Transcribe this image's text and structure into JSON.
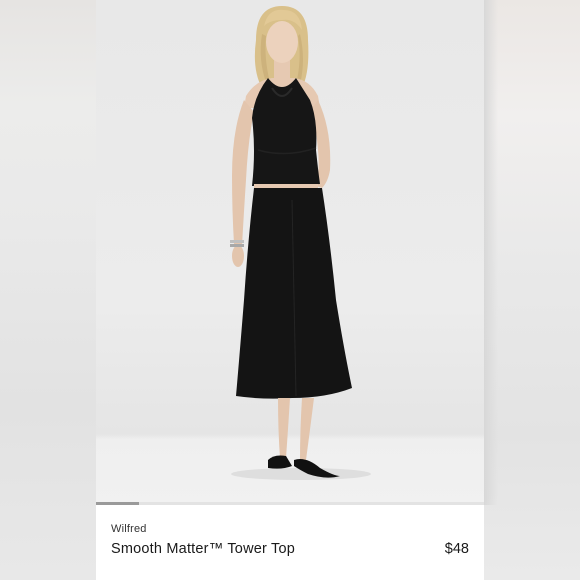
{
  "listing": {
    "brand": "Wilfred",
    "title": "Smooth Matter™ Tower Top",
    "price": "$48"
  },
  "gallery": {
    "current_image_progress": 0.11
  },
  "icons": {
    "product_photo": "model-wearing-black-halter-top-and-midi-skirt-photo"
  },
  "colors": {
    "card_bg": "#ffffff",
    "photo_bg": "#e9e9e9",
    "garment": "#151515",
    "text": "#1a1a1a"
  }
}
